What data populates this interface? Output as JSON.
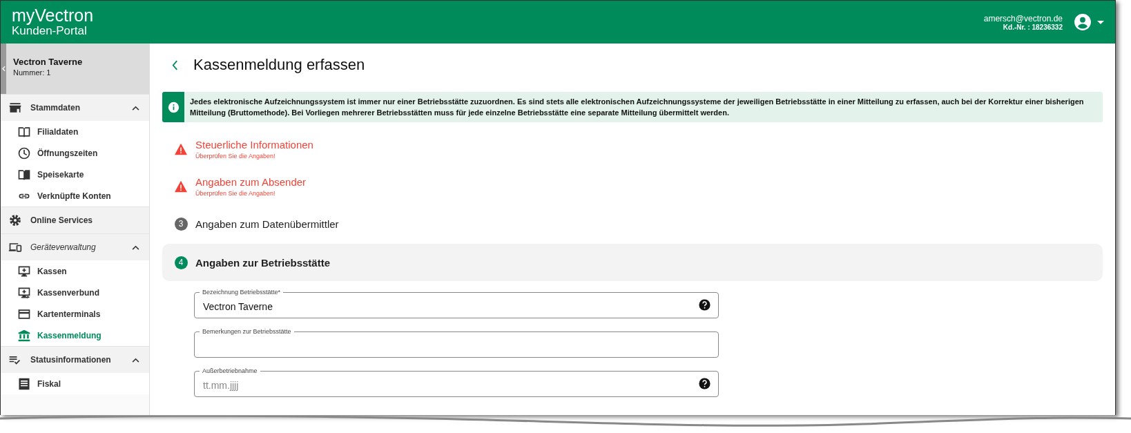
{
  "header": {
    "logo": "my**Vectron**",
    "subtitle": "Kunden-Portal",
    "email": "amersch@vectron.de",
    "customer_no": "Kd.-Nr. : 18236332"
  },
  "sidebar": {
    "store_name": "Vectron Taverne",
    "store_number": "Nummer: 1",
    "groups": [
      {
        "label": "Stammdaten",
        "emphasized": false,
        "expanded": true,
        "items": [
          {
            "label": "Filialdaten",
            "selected": false
          },
          {
            "label": "Öffnungszeiten",
            "selected": false
          },
          {
            "label": "Speisekarte",
            "selected": false
          },
          {
            "label": "Verknüpfte Konten",
            "selected": false
          }
        ]
      },
      {
        "label": "Online Services",
        "emphasized": false
      },
      {
        "label": "Geräteverwaltung",
        "emphasized": true,
        "expanded": true,
        "items": [
          {
            "label": "Kassen",
            "selected": false
          },
          {
            "label": "Kassenverbund",
            "selected": false
          },
          {
            "label": "Kartenterminals",
            "selected": false
          },
          {
            "label": "Kassenmeldung",
            "selected": true
          }
        ]
      },
      {
        "label": "Statusinformationen",
        "emphasized": false,
        "expanded": true,
        "items": [
          {
            "label": "Fiskal",
            "selected": false
          }
        ]
      }
    ]
  },
  "page": {
    "title": "Kassenmeldung erfassen",
    "info": "Jedes elektronische Aufzeichnungssystem ist immer nur einer Betriebsstätte zuzuordnen. Es sind stets alle elektronischen Aufzeichnungssysteme der jeweiligen Betriebsstätte in einer Mitteilung zu erfassen, auch bei der Korrektur einer bisherigen Mitteilung (Bruttomethode). Bei Vorliegen mehrerer Betriebsstätten muss für jede einzelne Betriebsstätte eine separate Mitteilung übermittelt werden.",
    "steps": [
      {
        "kind": "error",
        "title": "Steuerliche Informationen",
        "subtitle": "Überprüfen Sie die Angaben!",
        "selected": false
      },
      {
        "kind": "error",
        "title": "Angaben zum Absender",
        "subtitle": "Überprüfen Sie die Angaben!",
        "selected": false
      },
      {
        "kind": "number",
        "number": "3",
        "title": "Angaben zum Datenübermittler",
        "selected": false
      },
      {
        "kind": "number",
        "number": "4",
        "title": "Angaben zur Betriebsstätte",
        "selected": true
      }
    ],
    "fields": [
      {
        "label": "Bezeichnung Betriebsstätte*",
        "value": "Vectron Taverne",
        "help": true
      },
      {
        "label": "Bemerkungen zur Betriebsstätte",
        "help": false
      },
      {
        "label": "Außerbetriebnahme",
        "placeholder": "tt.mm.jjjj",
        "help": true
      }
    ]
  }
}
